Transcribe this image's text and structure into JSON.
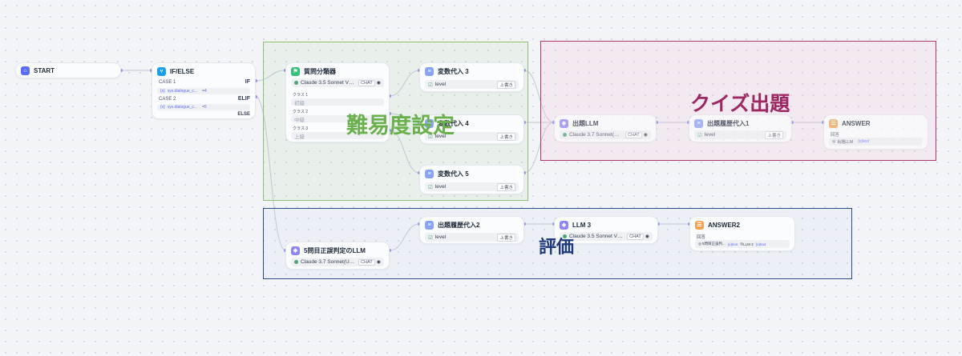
{
  "groups": {
    "difficulty": {
      "label": "難易度設定",
      "color": "#6ab04c"
    },
    "quiz": {
      "label": "クイズ出題",
      "color": "#9c2763"
    },
    "eval": {
      "label": "評価",
      "color": "#1f3a7a"
    }
  },
  "icons": {
    "start": "home-icon",
    "ifelse": "branch-icon",
    "classifier": "classifier-icon",
    "assigner": "variable-icon",
    "llm": "llm-icon",
    "answer": "answer-icon"
  },
  "colors": {
    "start": "#5b6cf6",
    "ifelse": "#1aa0e8",
    "classifier": "#34c27a",
    "assigner": "#8aa3f5",
    "llm": "#8e86f5",
    "answer": "#f5a14e"
  },
  "nodes": {
    "start": {
      "title": "START"
    },
    "ifelse": {
      "title": "IF/ELSE",
      "case1": "CASE 1",
      "case1_kw": "IF",
      "case1_var": "sys.dialogue_c...",
      "case1_val": "4",
      "case2": "CASE 2",
      "case2_kw": "ELIF",
      "case2_var": "sys.dialogue_c...",
      "case2_val": "5",
      "else_kw": "ELSE"
    },
    "classifier": {
      "title": "質問分類器",
      "model": "Claude 3.5 Sonnet V2(...",
      "mode": "CHAT",
      "classes": [
        {
          "name": "クラス 1",
          "value": "初級"
        },
        {
          "name": "クラス 2",
          "value": "中級"
        },
        {
          "name": "クラス 3",
          "value": "上級"
        }
      ]
    },
    "assign3": {
      "title": "変数代入 3",
      "var": "level",
      "op": "上書き"
    },
    "assign4": {
      "title": "変数代入 4",
      "var": "level",
      "op": "上書き"
    },
    "assign5": {
      "title": "変数代入 5",
      "var": "level",
      "op": "上書き"
    },
    "quiz_llm": {
      "title": "出題LLM",
      "model": "Claude 3.7 Sonnet(US...",
      "mode": "CHAT"
    },
    "quiz_hist": {
      "title": "出題履歴代入1",
      "var": "level",
      "op": "上書き"
    },
    "answer": {
      "title": "ANSWER",
      "label": "回答",
      "ref1": "出題LLM",
      "ref2": "text"
    },
    "judge_llm": {
      "title": "5問目正誤判定のLLM",
      "model": "Claude 3.7 Sonnet(US...",
      "mode": "CHAT"
    },
    "hist2": {
      "title": "出題履歴代入2",
      "var": "level",
      "op": "上書き"
    },
    "llm3": {
      "title": "LLM 3",
      "model": "Claude 3.5 Sonnet V2(...",
      "mode": "CHAT"
    },
    "answer2": {
      "title": "ANSWER2",
      "label": "回答",
      "ref1": "5問目正誤判...",
      "ref2": "text",
      "ref3": "LLM 3",
      "ref4": "text"
    }
  }
}
